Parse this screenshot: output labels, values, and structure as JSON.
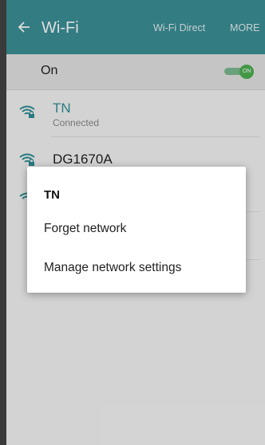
{
  "appbar": {
    "title": "Wi-Fi",
    "back_icon": "arrow-left-icon",
    "actions": [
      "Wi-Fi Direct",
      "MORE"
    ]
  },
  "main_toggle": {
    "label": "On",
    "state_text": "ON",
    "on": true
  },
  "networks": [
    {
      "name": "TN",
      "status": "Connected",
      "icon": "wifi-locked-icon"
    },
    {
      "name": "DG1670A",
      "status": "",
      "icon": "wifi-locked-icon"
    }
  ],
  "dialog": {
    "title": "TN",
    "options": [
      "Forget network",
      "Manage network settings"
    ]
  },
  "colors": {
    "appbar": "#3a8f96",
    "accent_text": "#2f8e95",
    "toggle_on": "#4caf50"
  }
}
